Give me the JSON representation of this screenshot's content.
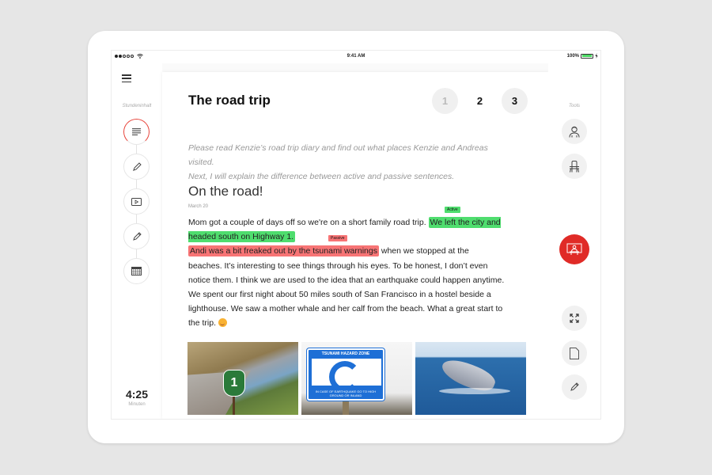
{
  "status_bar": {
    "time": "9:41 AM",
    "battery": "100%",
    "signal_bars_filled": 2,
    "signal_bars_total": 5
  },
  "left_rail": {
    "menu_icon": "hamburger-menu-icon",
    "section_label": "Stundeninhalt",
    "steps": [
      {
        "icon": "text-lines-icon",
        "active": true
      },
      {
        "icon": "pencil-icon",
        "active": false
      },
      {
        "icon": "video-icon",
        "active": false
      },
      {
        "icon": "pen-icon",
        "active": false
      },
      {
        "icon": "calendar-grid-icon",
        "active": false
      }
    ],
    "timer": "4:25",
    "timer_unit": "Minuten"
  },
  "content": {
    "title": "The road trip",
    "pages": [
      "1",
      "2",
      "3"
    ],
    "current_page": "2",
    "intro_line1": "Please read Kenzie’s road trip diary and find out what places Kenzie and Andreas visited.",
    "intro_line2": "Next, I will explain the difference between active and passive sentences.",
    "entry_heading": "On the road!",
    "entry_date": "March 20",
    "tag_active": "Active",
    "tag_passive": "Passive",
    "body": {
      "p1_plain": "Mom got a couple of days off so we're on a short family road trip. ",
      "p1_active": "We left the city and headed south on Highway 1.",
      "p2_passive": "Andi was a bit freaked out by the tsunami warnings",
      "p2_rest": " when we stopped at the beaches. It’s interesting to see things through his eyes. To be honest, I don’t even notice them. I think we are used to the idea that an earthquake could happen anytime.",
      "p3": "We spent our first night about 50 miles south of San Francisco in a hostel beside a lighthouse. We saw a mother whale and her calf from the beach. What a great start to the trip. ",
      "emoji": "smiling-face-emoji"
    },
    "photos": [
      {
        "alt": "Highway 1 coastal road with California 1 sign",
        "sign_text": "1"
      },
      {
        "alt": "Tsunami hazard zone sign",
        "top_text": "TSUNAMI HAZARD ZONE",
        "bottom_text": "IN CASE OF EARTHQUAKE GO TO HIGH GROUND OR INLAND"
      },
      {
        "alt": "Whale breaching in the ocean"
      }
    ]
  },
  "right_rail": {
    "section_label": "Tools",
    "tools": [
      {
        "icon": "student-icon"
      },
      {
        "icon": "desk-chair-icon"
      },
      {
        "icon": "teacher-presentation-icon",
        "highlighted": true
      },
      {
        "icon": "fullscreen-expand-icon"
      },
      {
        "icon": "document-icon"
      },
      {
        "icon": "pencil-icon"
      }
    ],
    "accent_color": "#e02b27"
  },
  "colors": {
    "active_highlight": "#4fdd6e",
    "passive_highlight": "#f77475",
    "accent": "#e02b27"
  }
}
